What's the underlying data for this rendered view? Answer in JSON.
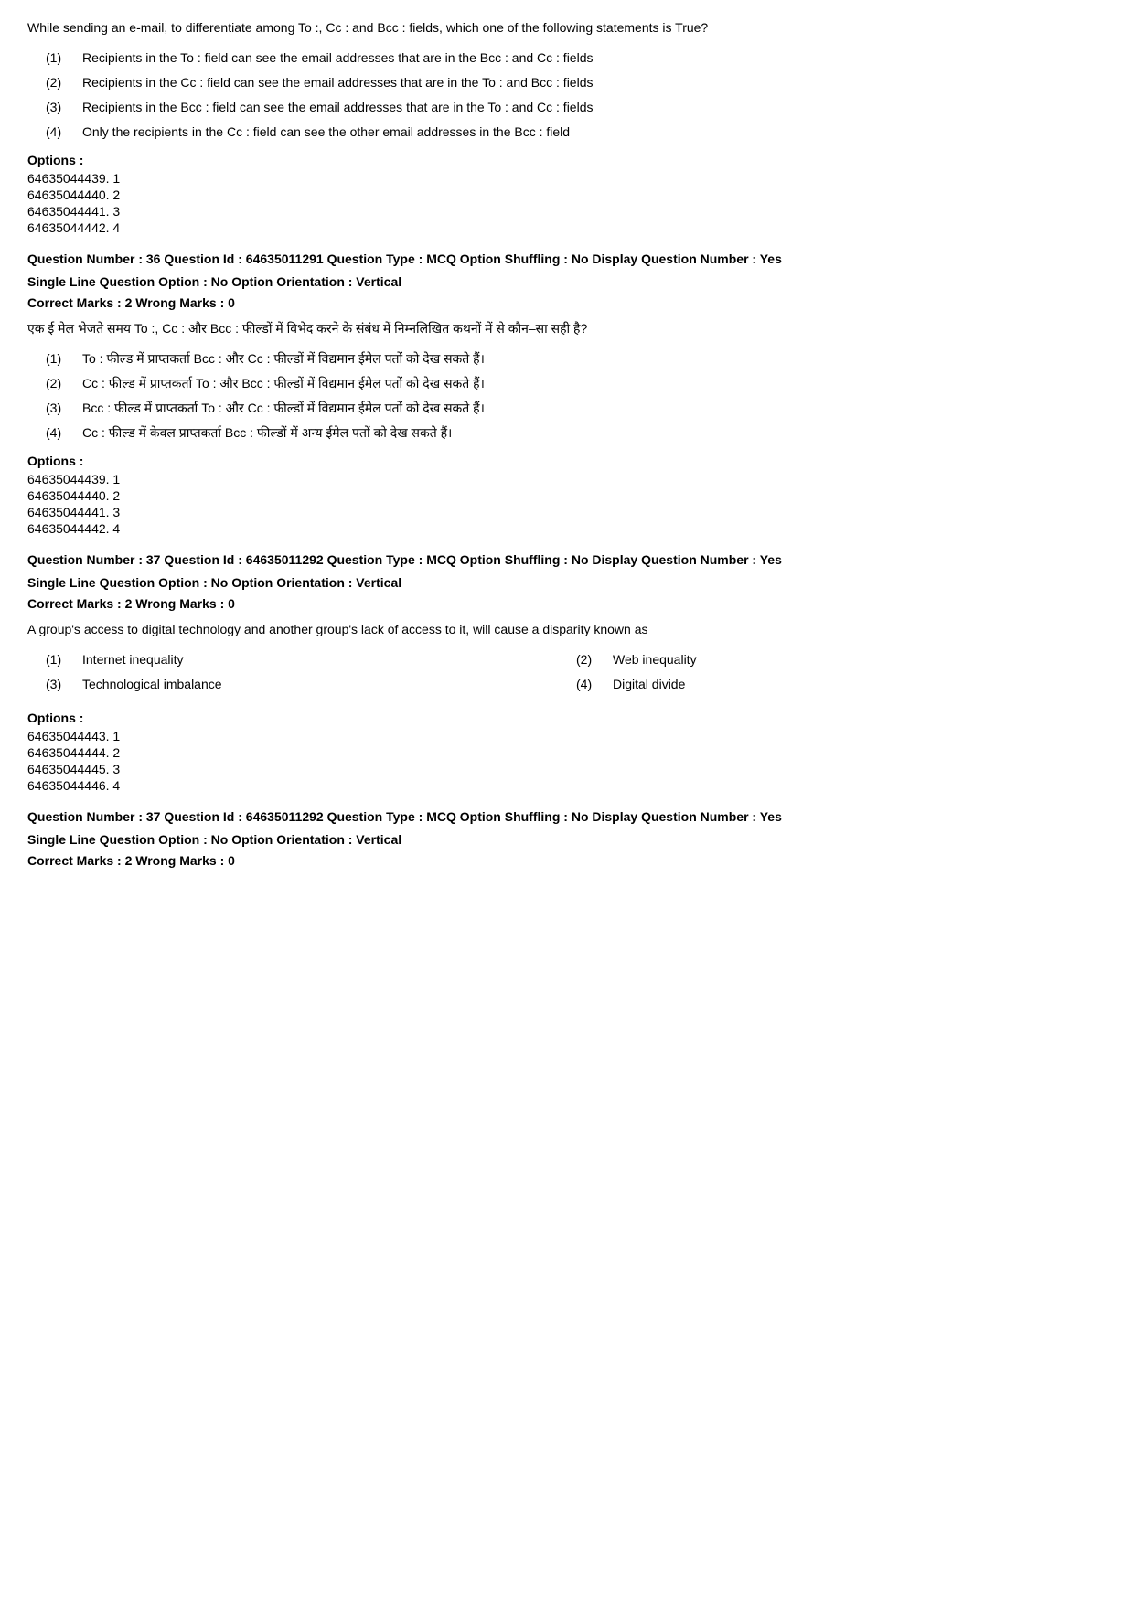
{
  "q35_english": {
    "question": "While sending an e-mail, to differentiate among To :, Cc : and Bcc : fields, which one of the following statements is True?",
    "options": [
      {
        "num": "(1)",
        "text": "Recipients in the To : field can see the email addresses that are in the Bcc : and Cc : fields"
      },
      {
        "num": "(2)",
        "text": "Recipients in the Cc : field can see the email addresses that are in the To : and Bcc : fields"
      },
      {
        "num": "(3)",
        "text": "Recipients in the Bcc : field can see the email addresses that are in the To : and Cc : fields"
      },
      {
        "num": "(4)",
        "text": "Only the recipients in the Cc : field can see the other email addresses in the Bcc : field"
      }
    ],
    "options_label": "Options :",
    "option_codes": [
      "64635044439. 1",
      "64635044440. 2",
      "64635044441. 3",
      "64635044442. 4"
    ]
  },
  "q36_meta": {
    "line1": "Question Number : 36  Question Id : 64635011291  Question Type : MCQ  Option Shuffling : No  Display Question Number : Yes",
    "line2": "Single Line Question Option : No  Option Orientation : Vertical",
    "correct_marks": "Correct Marks : 2  Wrong Marks : 0"
  },
  "q36_hindi": {
    "question": "एक ई मेल भेजते समय To :, Cc : और Bcc : फील्डों में विभेद करने के संबंध में निम्नलिखित कथनों में से कौन–सा सही है?",
    "options": [
      {
        "num": "(1)",
        "text": "To : फील्ड में प्राप्तकर्ता Bcc : और Cc : फील्डों में विद्यमान ईमेल पतों को देख सकते हैं।"
      },
      {
        "num": "(2)",
        "text": "Cc : फील्ड में प्राप्तकर्ता To : और Bcc : फील्डों में विद्यमान ईमेल पतों को देख सकते हैं।"
      },
      {
        "num": "(3)",
        "text": "Bcc : फील्ड में प्राप्तकर्ता To : और Cc : फील्डों में विद्यमान ईमेल पतों को देख सकते हैं।"
      },
      {
        "num": "(4)",
        "text": "Cc : फील्ड में केवल प्राप्तकर्ता Bcc : फील्डों में अन्य ईमेल पतों को देख सकते हैं।"
      }
    ],
    "options_label": "Options :",
    "option_codes": [
      "64635044439. 1",
      "64635044440. 2",
      "64635044441. 3",
      "64635044442. 4"
    ]
  },
  "q37_meta": {
    "line1": "Question Number : 37  Question Id : 64635011292  Question Type : MCQ  Option Shuffling : No  Display Question Number : Yes",
    "line2": "Single Line Question Option : No  Option Orientation : Vertical",
    "correct_marks": "Correct Marks : 2  Wrong Marks : 0"
  },
  "q37_english": {
    "question": "A group's access to digital technology and another group's lack of access to it, will cause a disparity known as",
    "options_col1": [
      {
        "num": "(1)",
        "text": "Internet inequality"
      },
      {
        "num": "(3)",
        "text": "Technological imbalance"
      }
    ],
    "options_col2": [
      {
        "num": "(2)",
        "text": "Web inequality"
      },
      {
        "num": "(4)",
        "text": "Digital divide"
      }
    ],
    "options_label": "Options :",
    "option_codes": [
      "64635044443. 1",
      "64635044444. 2",
      "64635044445. 3",
      "64635044446. 4"
    ]
  },
  "q37_meta2": {
    "line1": "Question Number : 37  Question Id : 64635011292  Question Type : MCQ  Option Shuffling : No  Display Question Number : Yes",
    "line2": "Single Line Question Option : No  Option Orientation : Vertical",
    "correct_marks": "Correct Marks : 2  Wrong Marks : 0"
  }
}
